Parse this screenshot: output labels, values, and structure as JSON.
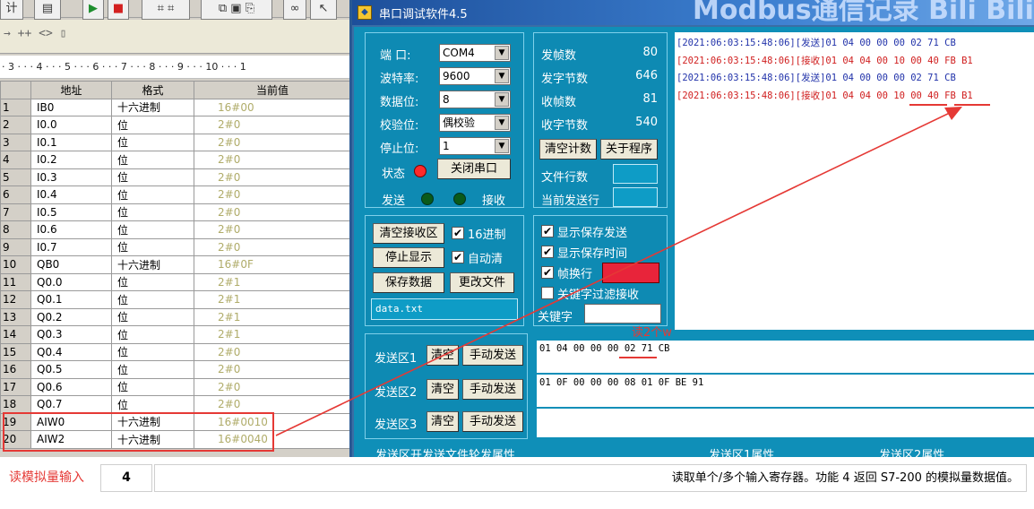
{
  "left": {
    "ruler_text": "· 3 · · · 4 · · · 5 · · · 6 · · · 7 · · · 8 · · · 9 · · · 10 · · · 1",
    "toolbar": {
      "btn_a": "计",
      "btn_b": "",
      "run_icon": "▶",
      "stop_icon": "■",
      "row2_text": "→  ++ <> ▯"
    },
    "columns": [
      "",
      "地址",
      "格式",
      "当前值"
    ],
    "rows": [
      [
        "1",
        "IB0",
        "十六进制",
        "16#00"
      ],
      [
        "2",
        "I0.0",
        "位",
        "2#0"
      ],
      [
        "3",
        "I0.1",
        "位",
        "2#0"
      ],
      [
        "4",
        "I0.2",
        "位",
        "2#0"
      ],
      [
        "5",
        "I0.3",
        "位",
        "2#0"
      ],
      [
        "6",
        "I0.4",
        "位",
        "2#0"
      ],
      [
        "7",
        "I0.5",
        "位",
        "2#0"
      ],
      [
        "8",
        "I0.6",
        "位",
        "2#0"
      ],
      [
        "9",
        "I0.7",
        "位",
        "2#0"
      ],
      [
        "10",
        "QB0",
        "十六进制",
        "16#0F"
      ],
      [
        "11",
        "Q0.0",
        "位",
        "2#1"
      ],
      [
        "12",
        "Q0.1",
        "位",
        "2#1"
      ],
      [
        "13",
        "Q0.2",
        "位",
        "2#1"
      ],
      [
        "14",
        "Q0.3",
        "位",
        "2#1"
      ],
      [
        "15",
        "Q0.4",
        "位",
        "2#0"
      ],
      [
        "16",
        "Q0.5",
        "位",
        "2#0"
      ],
      [
        "17",
        "Q0.6",
        "位",
        "2#0"
      ],
      [
        "18",
        "Q0.7",
        "位",
        "2#0"
      ],
      [
        "19",
        "AIW0",
        "十六进制",
        "16#0010"
      ],
      [
        "20",
        "AIW2",
        "十六进制",
        "16#0040"
      ]
    ]
  },
  "serial": {
    "title": "串口调试软件4.5",
    "watermark": "Modbus通信记录  Bili Bili",
    "config": {
      "port_label": "端  口:",
      "port_value": "COM4",
      "baud_label": "波特率:",
      "baud_value": "9600",
      "databits_label": "数据位:",
      "databits_value": "8",
      "parity_label": "校验位:",
      "parity_value": "偶校验",
      "stopbits_label": "停止位:",
      "stopbits_value": "1",
      "status_label": "状态",
      "close_port_button": "关闭串口",
      "send_label": "发送",
      "recv_label": "接收"
    },
    "counters": {
      "sent_frames_label": "发帧数",
      "sent_frames": "80",
      "sent_bytes_label": "发字节数",
      "sent_bytes": "646",
      "recv_frames_label": "收帧数",
      "recv_frames": "81",
      "recv_bytes_label": "收字节数",
      "recv_bytes": "540",
      "clear_count_button": "清空计数",
      "about_button": "关于程序",
      "file_lines_label": "文件行数",
      "current_line_label": "当前发送行"
    },
    "recv_controls": {
      "clear_recv_button": "清空接收区",
      "hex_checkbox": "16进制",
      "stop_display_button": "停止显示",
      "auto_clear_checkbox": "自动清",
      "save_data_button": "保存数据",
      "change_file_button": "更改文件",
      "file_name": "data.txt"
    },
    "display_options": {
      "show_send": "显示保存发送",
      "show_time": "显示保存时间",
      "frame_newline": "帧换行",
      "frame_newline_button": "",
      "keyword_filter": "关键字过滤接收",
      "keyword_label": "关键字"
    },
    "log_lines": [
      {
        "kind": "send",
        "text": "[2021:06:03:15:48:06][发送]01 04 00 00 00 02 71 CB"
      },
      {
        "kind": "recv",
        "text": "[2021:06:03:15:48:06][接收]01 04 04 00 10 00 40 FB B1"
      },
      {
        "kind": "send",
        "text": "[2021:06:03:15:48:06][发送]01 04 00 00 00 02 71 CB"
      },
      {
        "kind": "recv",
        "text": "[2021:06:03:15:48:06][接收]01 04 04 00 10 00 40 FB B1"
      }
    ],
    "send_areas": [
      {
        "label": "发送区1",
        "clear": "清空",
        "manual": "手动发送",
        "content": "01 04 00 00 00 02 71 CB"
      },
      {
        "label": "发送区2",
        "clear": "清空",
        "manual": "手动发送",
        "content": "01 0F 00 00 00 08 01 0F BE 91"
      },
      {
        "label": "发送区3",
        "clear": "清空",
        "manual": "手动发送",
        "content": ""
      }
    ],
    "annotation": "读2个w",
    "bottom_partial_labels": [
      "发送区开发送文件轮发属性",
      "发送区1属性",
      "发送区2属性"
    ]
  },
  "bottom": {
    "label": "读模拟量输入",
    "code": "4",
    "description": "读取单个/多个输入寄存器。功能 4 返回 S7-200 的模拟量数据值。"
  },
  "colors": {
    "highlight_red": "#e53935",
    "window_teal": "#0f8fb8",
    "status_led": "#ff2a2a",
    "green_led": "#0a5a1a"
  }
}
